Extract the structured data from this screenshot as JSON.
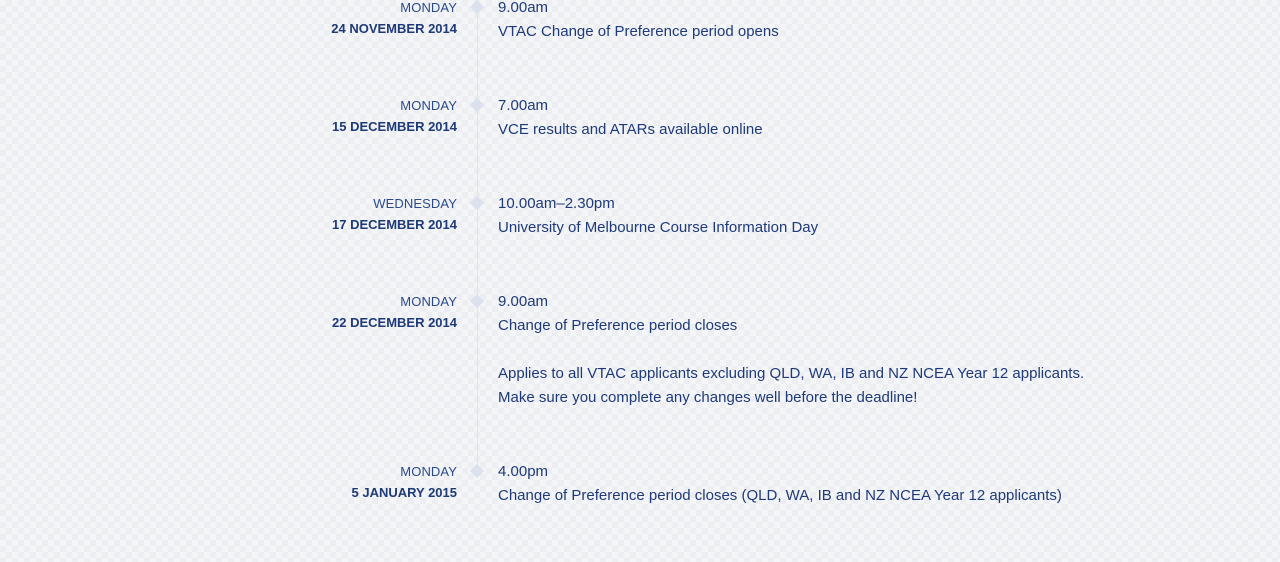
{
  "events": [
    {
      "day": "MONDAY",
      "date": "24 NOVEMBER 2014",
      "time": "9.00am",
      "description": "VTAC Change of Preference period opens"
    },
    {
      "day": "MONDAY",
      "date": "15 DECEMBER 2014",
      "time": "7.00am",
      "description": "VCE results and ATARs available online"
    },
    {
      "day": "WEDNESDAY",
      "date": "17 DECEMBER 2014",
      "time": "10.00am–2.30pm",
      "description": "University of Melbourne Course Information Day"
    },
    {
      "day": "MONDAY",
      "date": "22 DECEMBER 2014",
      "time": "9.00am",
      "description": "Change of Preference period closes",
      "note_line1": "Applies to all VTAC applicants excluding QLD, WA, IB and NZ NCEA Year 12 applicants.",
      "note_line2": "Make sure you complete any changes well before the deadline!"
    },
    {
      "day": "MONDAY",
      "date": "5 JANUARY 2015",
      "time": "4.00pm",
      "description": "Change of Preference period closes (QLD, WA, IB and NZ NCEA Year 12 applicants)"
    }
  ]
}
